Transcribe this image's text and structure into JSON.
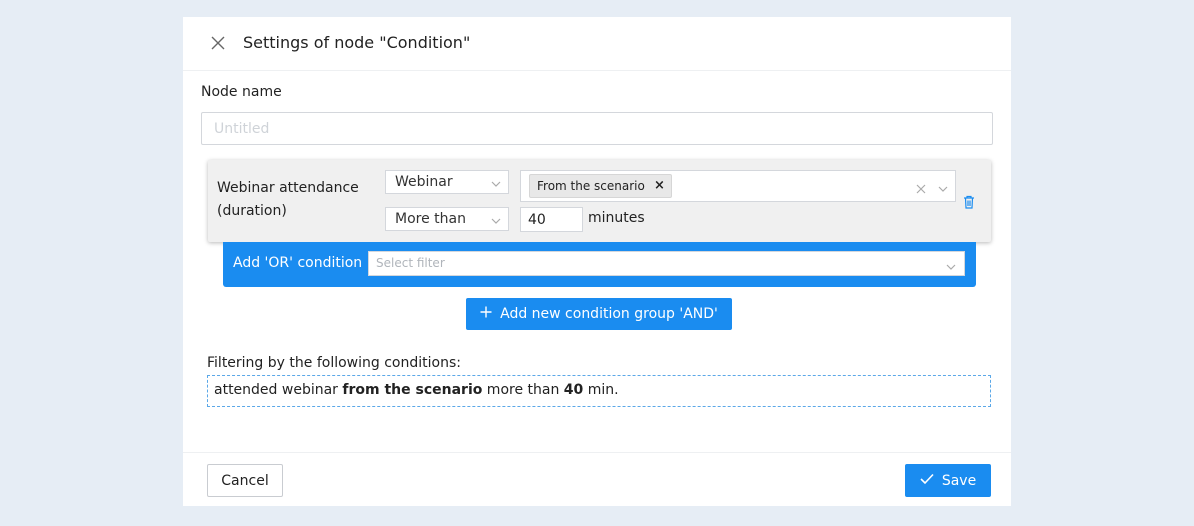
{
  "dialog": {
    "title": "Settings of node \"Condition\"",
    "close_icon": "close-icon"
  },
  "node_name": {
    "label": "Node name",
    "value": "",
    "placeholder": "Untitled"
  },
  "condition": {
    "label": "Webinar attendance (duration)",
    "type_select": "Webinar",
    "comparison_select": "More than",
    "tags": [
      "From the scenario"
    ],
    "amount": "40",
    "unit": "minutes",
    "delete_icon": "trash-icon"
  },
  "or_condition": {
    "label": "Add 'OR' condition",
    "placeholder": "Select filter"
  },
  "and_button": {
    "label": "Add new condition group 'AND'",
    "icon": "plus-icon"
  },
  "filter_summary": {
    "title": "Filtering by the following conditions:",
    "parts": [
      "attended webinar ",
      "from the scenario",
      " more than ",
      "40",
      " min."
    ]
  },
  "footer": {
    "cancel_label": "Cancel",
    "save_label": "Save",
    "save_icon": "check-icon"
  },
  "colors": {
    "accent": "#1a8cf0",
    "background": "#e6edf5",
    "card": "#f0f0f0"
  }
}
